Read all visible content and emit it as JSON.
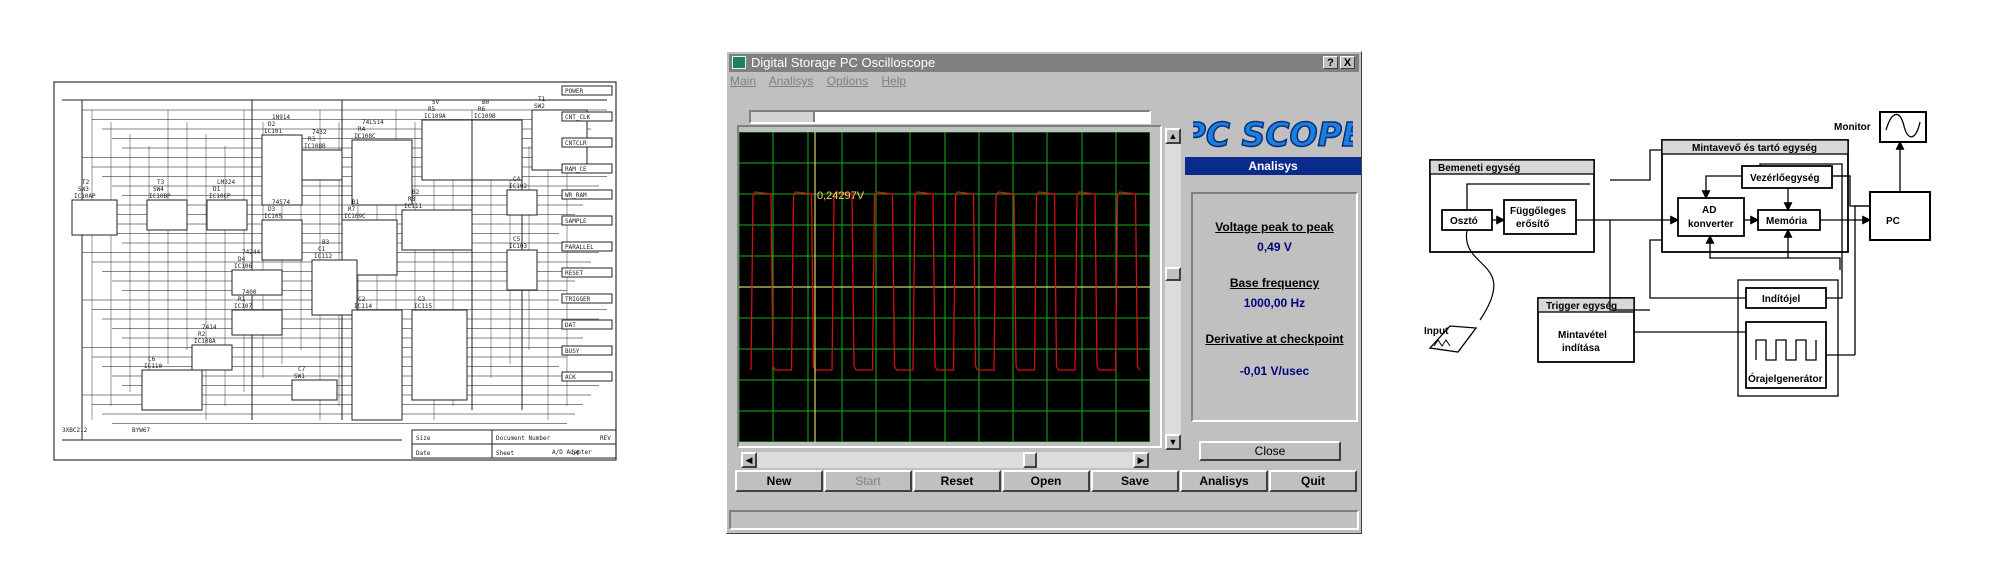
{
  "window": {
    "title": "Digital Storage PC Oscilloscope",
    "help_button": "?",
    "close_button": "X"
  },
  "menu": [
    "Main",
    "Analisys",
    "Options",
    "Help"
  ],
  "scope": {
    "cursor_readout": "0,24297V",
    "trace_color": "#d01010",
    "grid_color": "#18b018",
    "cursor_color": "#ffff80"
  },
  "logo_text": "PC SCOPE",
  "analysis": {
    "title": "Analisys",
    "voltage_label": "Voltage peak to peak",
    "voltage_value": "0,49 V",
    "freq_label": "Base frequency",
    "freq_value": "1000,00 Hz",
    "deriv_label": "Derivative at checkpoint",
    "deriv_value": "-0,01 V/usec",
    "close_label": "Close"
  },
  "toolbar": [
    "New",
    "Start",
    "Reset",
    "Open",
    "Save",
    "Analisys",
    "Quit"
  ],
  "schematic": {
    "parts": [
      "IC10AP",
      "IC10BP",
      "IC10CP",
      "IC101",
      "IC105",
      "IC106",
      "IC107",
      "IC108A",
      "IC108B",
      "IC108C",
      "IC109A",
      "IC109B",
      "IC109C",
      "IC111",
      "IC112",
      "IC114",
      "IC115",
      "IC102",
      "IC103",
      "IC110",
      "SW1",
      "SW2",
      "SW3",
      "SW4",
      "D1",
      "D2",
      "D3",
      "D4",
      "R1",
      "R2",
      "R3",
      "R4",
      "R5",
      "R6",
      "R7",
      "R8",
      "C1",
      "C2",
      "C3",
      "C4",
      "C5",
      "C6",
      "C7",
      "T1",
      "T2",
      "T3",
      "LM324",
      "1N914",
      "74574",
      "74244",
      "7400",
      "7414",
      "7432",
      "74LS14",
      "5V",
      "B0",
      "B1",
      "B2",
      "B3"
    ],
    "signals": [
      "POWER",
      "CNT_CLK",
      "CNTCLR",
      "RAM_CE",
      "WR_RAM",
      "SAMPLE",
      "PARALLEL",
      "RESET",
      "TRIGGER",
      "DAT",
      "BUSY",
      "ACK"
    ],
    "bottom": [
      "Size",
      "Document Number",
      "A/D Adapter",
      "REV",
      "Date",
      "Sheet",
      "of"
    ],
    "footer": [
      "3XBC212",
      "BYW67"
    ]
  },
  "blockdiag": {
    "input_unit": "Bemeneti egység",
    "divider": "Osztó",
    "amplifier": [
      "Függőleges",
      "erősítő"
    ],
    "sampler_unit": "Mintavevő és tartó egység",
    "controller": "Vezérlőegység",
    "adc": [
      "AD",
      "konverter"
    ],
    "memory": "Memória",
    "pc": "PC",
    "monitor": "Monitor",
    "input": "Input",
    "trigger_unit": "Trigger egység",
    "trigger_start": [
      "Mintavétel",
      "indítása"
    ],
    "start_signal": "Indítójel",
    "clock_gen": "Órajelgenerátor"
  }
}
